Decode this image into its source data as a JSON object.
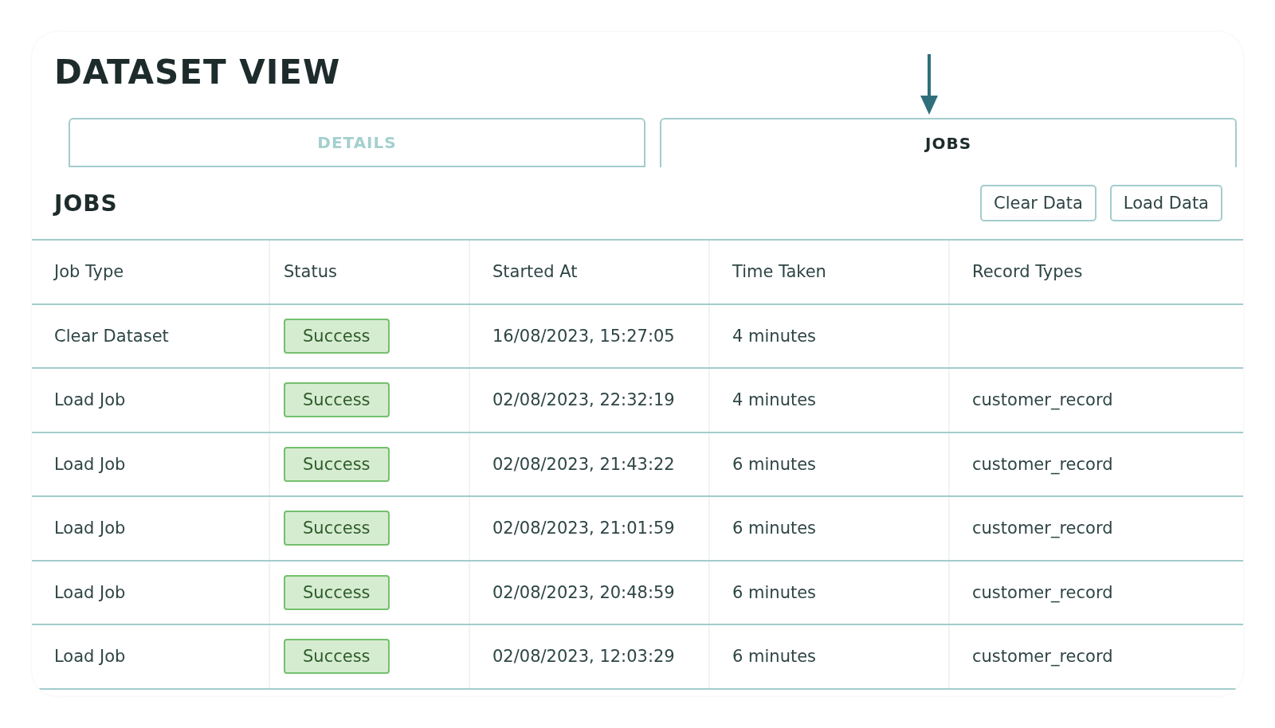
{
  "title": "DATASET VIEW",
  "tabs": [
    {
      "label": "DETAILS",
      "selected": false
    },
    {
      "label": "JOBS",
      "selected": true
    }
  ],
  "section": {
    "title": "JOBS",
    "buttons": [
      "Clear Data",
      "Load Data"
    ]
  },
  "table": {
    "columns": [
      "Job Type",
      "Status",
      "Started At",
      "Time Taken",
      "Record Types"
    ],
    "rows": [
      {
        "job_type": "Clear Dataset",
        "status": "Success",
        "started_at": "16/08/2023, 15:27:05",
        "time_taken": "4 minutes",
        "record_types": ""
      },
      {
        "job_type": "Load Job",
        "status": "Success",
        "started_at": "02/08/2023, 22:32:19",
        "time_taken": "4 minutes",
        "record_types": "customer_record"
      },
      {
        "job_type": "Load Job",
        "status": "Success",
        "started_at": "02/08/2023, 21:43:22",
        "time_taken": "6 minutes",
        "record_types": "customer_record"
      },
      {
        "job_type": "Load Job",
        "status": "Success",
        "started_at": "02/08/2023, 21:01:59",
        "time_taken": "6 minutes",
        "record_types": "customer_record"
      },
      {
        "job_type": "Load Job",
        "status": "Success",
        "started_at": "02/08/2023, 20:48:59",
        "time_taken": "6 minutes",
        "record_types": "customer_record"
      },
      {
        "job_type": "Load Job",
        "status": "Success",
        "started_at": "02/08/2023, 12:03:29",
        "time_taken": "6 minutes",
        "record_types": "customer_record"
      }
    ]
  }
}
